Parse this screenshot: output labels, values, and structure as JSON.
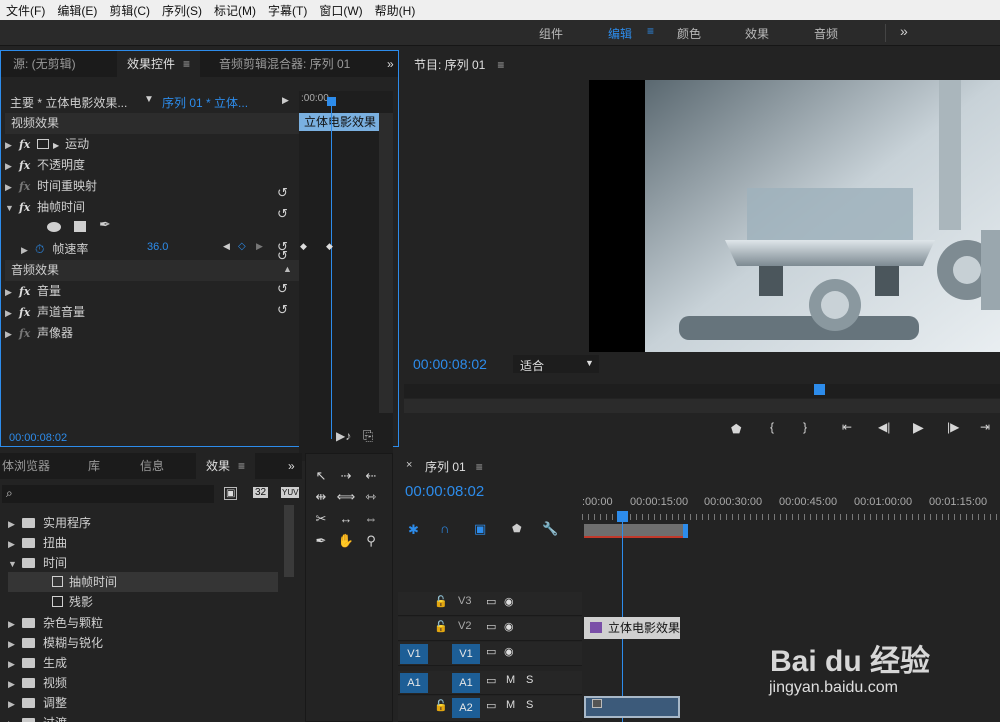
{
  "menu": [
    "文件(F)",
    "编辑(E)",
    "剪辑(C)",
    "序列(S)",
    "标记(M)",
    "字幕(T)",
    "窗口(W)",
    "帮助(H)"
  ],
  "workspaces": {
    "items": [
      "组件",
      "编辑",
      "颜色",
      "效果",
      "音频"
    ],
    "active": "编辑",
    "more": "»"
  },
  "ec_panel": {
    "tabs": [
      "源: (无剪辑)",
      "效果控件",
      "音频剪辑混合器: 序列 01"
    ],
    "master_label": "主要 * 立体电影效果...",
    "sequence_label": "序列 01 * 立体...",
    "timecode_ruler": ":00:00",
    "clip_label": "立体电影效果",
    "video_effects": "视频效果",
    "audio_effects": "音频效果",
    "rows": {
      "motion": "运动",
      "opacity": "不透明度",
      "time_remap": "时间重映射",
      "posterize": "抽帧时间",
      "frame_rate": "帧速率",
      "frame_rate_value": "36.0",
      "volume": "音量",
      "channel_volume": "声道音量",
      "panner": "声像器"
    },
    "timecode": "00:00:08:02"
  },
  "program": {
    "title": "节目: 序列 01",
    "timecode": "00:00:08:02",
    "fit": "适合"
  },
  "project": {
    "tabs": [
      "体浏览器",
      "库",
      "信息",
      "效果"
    ],
    "badges": [
      "32",
      "YUV"
    ],
    "tree": {
      "utility": "实用程序",
      "distort": "扭曲",
      "time": "时间",
      "posterize_time": "抽帧时间",
      "echo": "残影",
      "noise": "杂色与颗粒",
      "blur": "模糊与锐化",
      "generate": "生成",
      "video": "视频",
      "adjust": "调整",
      "transition": "过渡"
    }
  },
  "timeline": {
    "title": "序列 01",
    "timecode": "00:00:08:02",
    "ruler": [
      ":00:00",
      "00:00:15:00",
      "00:00:30:00",
      "00:00:45:00",
      "00:01:00:00",
      "00:01:15:00"
    ],
    "tracks": {
      "v3": "V3",
      "v2": "V2",
      "v1_src": "V1",
      "v1": "V1",
      "a1_src": "A1",
      "a1": "A1",
      "a2": "A2",
      "m": "M",
      "s": "S"
    },
    "clip_v2": "立体电影效果"
  },
  "watermark": {
    "brand": "Bai du 经验",
    "url": "jingyan.baidu.com"
  },
  "colors": {
    "accent": "#2d8ceb",
    "panel_bg": "#232323",
    "track_on": "#1d5e96"
  }
}
